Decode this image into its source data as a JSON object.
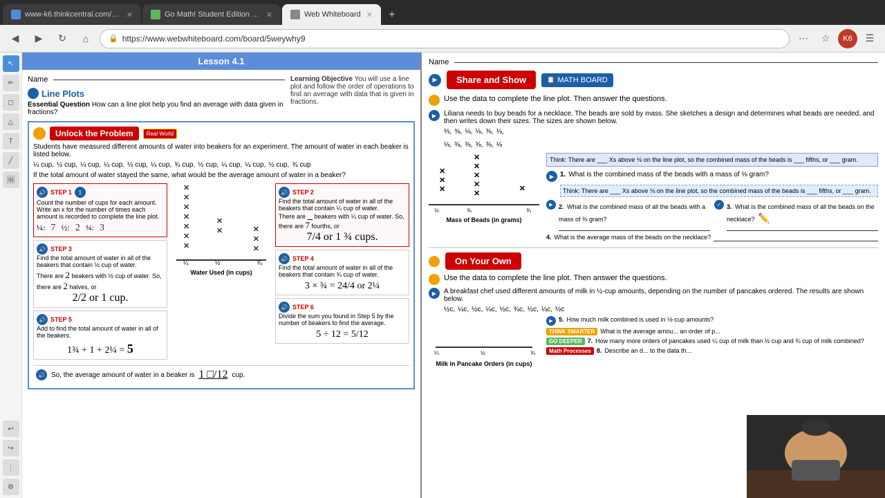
{
  "browser": {
    "tabs": [
      {
        "label": "www-k6.thinkcentral.com/dash...",
        "type": "blue",
        "active": false
      },
      {
        "label": "Go Math! Student Edition eBo...",
        "type": "green",
        "active": false
      },
      {
        "label": "Web Whiteboard",
        "type": "gray",
        "active": true
      }
    ],
    "url": "https://www.webwhiteboard.com/board/5weywhy9"
  },
  "left_panel": {
    "lesson": "Lesson 4.1",
    "section_title": "Line Plots",
    "learning_obj_label": "Learning Objective",
    "learning_obj_text": "You will use a line plot and follow the order of operations to find an average with data that is given in fractions.",
    "essential_q_label": "Essential Question",
    "essential_q_text": "How can a line plot help you find an average with data given in fractions?",
    "unlock_label": "Unlock the Problem",
    "real_world_label": "Real World",
    "problem_text": "Students have measured different amounts of water into beakers for an experiment. The amount of water in each beaker is listed below.",
    "cups_text": "If the total amount of water stayed the same, what would be the average amount of water in a beaker?",
    "step1_label": "STEP 1",
    "step1_text": "Count the number of cups for each amount. Write an x for the number of times each amount is recorded to complete the line plot.",
    "step2_label": "STEP 2",
    "step2_text": "Find the total amount of water in all of the beakers that contain ¼ cup of water.",
    "step2_detail": "There are ___ beakers with ¼ cup of water. So, there are ___ fourths, or ___ or 1 ___ cups.",
    "step3_label": "STEP 3",
    "step3_text": "Find the total amount of water in all of the beakers that contain ½ cup of water.",
    "step3_detail": "There are ___ beakers with ½ cup of water. So, there are ___ halves, or ___ or 1 cup.",
    "step4_label": "STEP 4",
    "step4_text": "Find the total amount of water in all of the beakers that contain ¾ cup of water.",
    "step5_label": "STEP 5",
    "step5_text": "Add to find the total amount of water in all of the beakers.",
    "step6_label": "STEP 6",
    "step6_text": "Divide the sum you found in Step 5 by the number of beakers to find the average.",
    "conclusion": "So, the average amount of water in a beaker is ___ cup.",
    "water_label": "Water Used (in cups)"
  },
  "right_panel": {
    "name_label": "Name",
    "share_btn": "Share and Show",
    "math_board_label": "MATH BOARD",
    "instruction": "Use the data to complete the line plot. Then answer the questions.",
    "q1_text": "What is the combined mass of the beads with a mass of ⅛ gram?",
    "q2_text": "What is the combined mass of all the beads with a mass of ⅜ gram?",
    "q3_text": "What is the combined mass of all the beads on the necklace?",
    "q4_text": "What is the average mass of the beads on the necklace?",
    "think_text": "Think: There are ___ Xs above ⅛ on the line plot, so the combined mass of the beads is ___ fifths, or ___ gram.",
    "bead_context": "Liliana needs to buy beads for a necklace. The beads are sold by mass. She sketches a design and determines what beads are needed, and then writes down their sizes. The sizes are shown below.",
    "mass_label": "Mass of Beads (in grams)",
    "on_your_own_label": "On Your Own",
    "on_your_own_instruction": "Use the data to complete the line plot. Then answer the questions.",
    "chef_context": "A breakfast chef used different amounts of milk in ½-cup amounts, depending on the number of pancakes ordered. The results are shown below.",
    "milk_label": "Milk in Pancake Orders (in cups)",
    "q5_text": "How much milk combined is used in ½-cup amounts?",
    "q6_label": "THINK SMARTER",
    "q6_text": "What is the average amou... an order of p...",
    "q7_label": "GO DEEPER",
    "q7_text": "How many more orders of pancakes used ¼ cup of milk than ½ cup and ¾ cup of milk combined?",
    "q8_label": "Math Processes",
    "q8_text": "Describe an d... to the data th..."
  },
  "tools": [
    "pointer",
    "pen",
    "eraser",
    "shapes",
    "text",
    "line",
    "undo",
    "redo"
  ]
}
